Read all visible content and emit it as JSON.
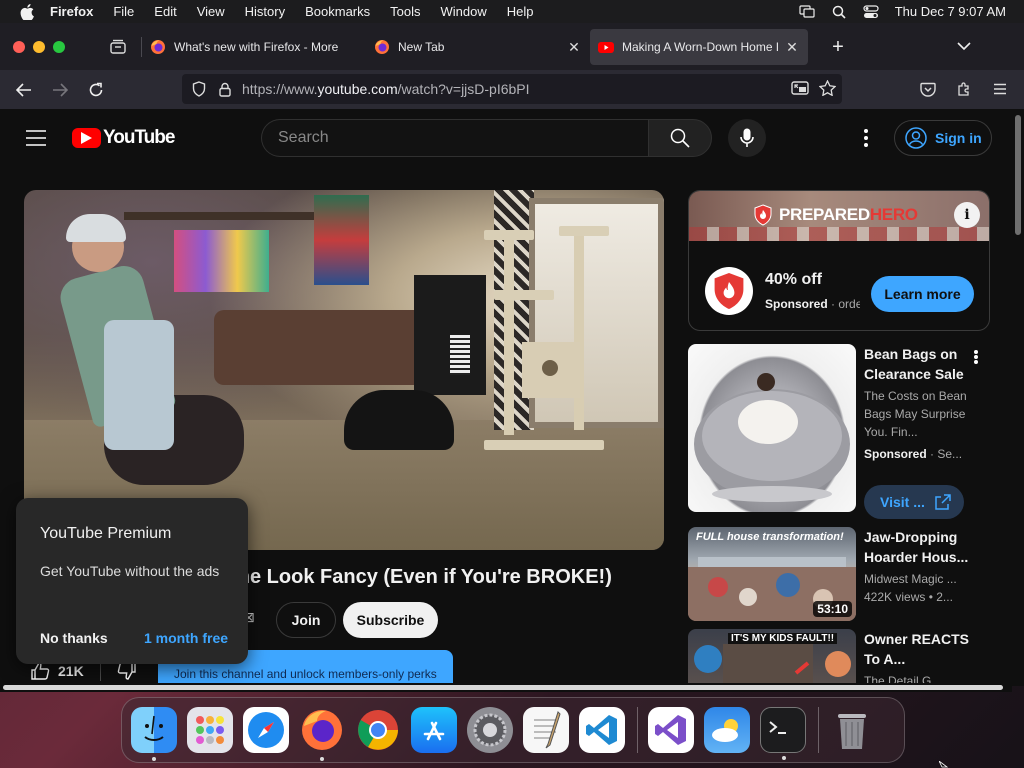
{
  "menubar": {
    "app_name": "Firefox",
    "items": [
      "File",
      "Edit",
      "View",
      "History",
      "Bookmarks",
      "Tools",
      "Window",
      "Help"
    ],
    "clock": "Thu Dec 7  9:07 AM"
  },
  "tabs": [
    {
      "title": "What's new with Firefox - More",
      "active": false
    },
    {
      "title": "New Tab",
      "active": false
    },
    {
      "title": "Making A Worn-Down Home Lo",
      "active": true
    }
  ],
  "navbar": {
    "url_prefix": "https://www.",
    "url_host": "youtube.com",
    "url_path": "/watch?v=jjsD-pI6bPI"
  },
  "youtube": {
    "logo_text": "YouTube",
    "search_placeholder": "Search",
    "sign_in": "Sign in"
  },
  "ad": {
    "brand_a": "PREPARED",
    "brand_b": "HERO",
    "headline": "40% off",
    "sponsored": "Sponsored",
    "advertiser": "orde",
    "cta": "Learn more",
    "brand_color": "#e53935"
  },
  "recommendations": [
    {
      "title": "Bean Bags on Clearance Sale",
      "description": "The Costs on Bean Bags May Surprise You. Fin...",
      "sponsored": "Sponsored",
      "extra": "Se...",
      "cta": "Visit ..."
    },
    {
      "title": "Jaw-Dropping Hoarder Hous...",
      "channel": "Midwest Magic ...",
      "views": "422K views",
      "age": "2...",
      "duration": "53:10",
      "thumb_caption": "FULL house transformation!"
    },
    {
      "title": "Owner REACTS To A...",
      "channel": "The Detail G...",
      "thumb_caption": "IT'S MY KIDS FAULT!!"
    }
  ],
  "video": {
    "title_visible": "ome Look Fancy (Even if You're BROKE!)",
    "join": "Join",
    "subscribe": "Subscribe",
    "join_perks": "Join this channel and unlock members-only perks",
    "likes": "21K"
  },
  "premium_popup": {
    "title": "YouTube Premium",
    "description": "Get YouTube without the ads",
    "no_thanks": "No thanks",
    "free_trial": "1 month free"
  },
  "dock": {
    "apps": [
      "finder-icon",
      "launchpad-icon",
      "safari-icon",
      "firefox-icon",
      "chrome-icon",
      "app-store-icon",
      "system-settings-icon",
      "textedit-icon",
      "vscode-icon",
      "visual-studio-icon",
      "weather-icon",
      "terminal-icon",
      "trash-icon"
    ]
  },
  "colors": {
    "accent_blue": "#3ea6ff",
    "youtube_red": "#ff0000",
    "page_bg": "#0f0f0f"
  }
}
